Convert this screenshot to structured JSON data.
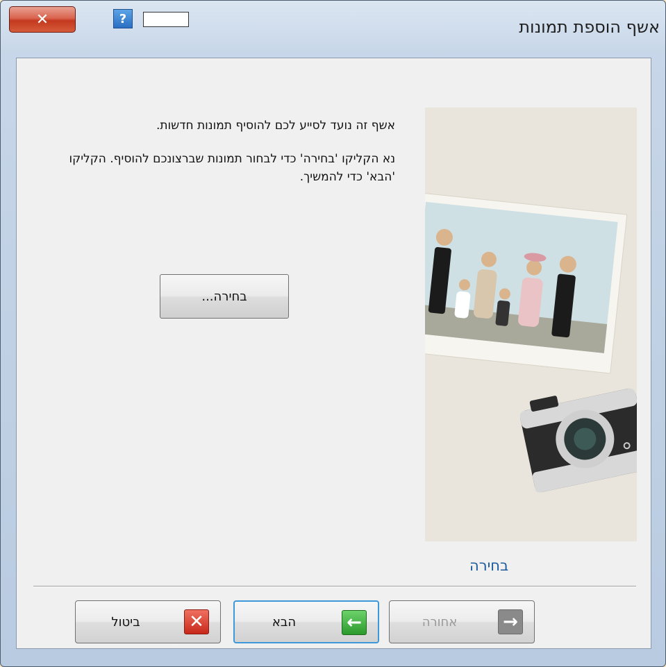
{
  "window": {
    "title": "אשף הוספת תמונות",
    "close_label": "✕",
    "help_label": "?"
  },
  "intro": {
    "line1": "אשף זה נועד לסייע לכם להוסיף תמונות חדשות.",
    "line2": "נא הקליקו 'בחירה' כדי לבחור תמונות שברצונכם להוסיף. הקליקו 'הבא' כדי להמשיך."
  },
  "browse_button": {
    "label": "בחירה..."
  },
  "side_link": {
    "label": "בחירה"
  },
  "footer": {
    "cancel_label": "ביטול",
    "next_label": "הבא",
    "back_label": "אחורה"
  },
  "icons": {
    "cancel": "x-icon",
    "next": "arrow-left-icon",
    "back": "arrow-right-icon"
  },
  "colors": {
    "close_red": "#c4391f",
    "link_blue": "#1c5a9c",
    "next_green": "#2c9a2c",
    "focus_blue": "#3c98d8"
  }
}
